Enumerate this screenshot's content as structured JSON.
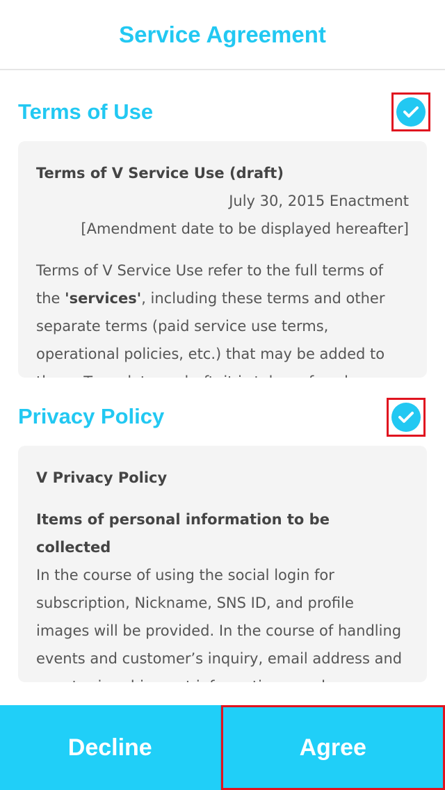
{
  "header": {
    "title": "Service Agreement"
  },
  "terms": {
    "title": "Terms of Use",
    "checked": true,
    "doc_title": "Terms of V Service Use (draft)",
    "enactment": "July 30, 2015 Enactment",
    "amendment": "[Amendment date to be displayed hereafter]",
    "body_prefix": "Terms of V Service Use refer to the full terms of the ",
    "body_bold": "'services'",
    "body_suffix": ", including these terms and other separate terms (paid service use terms, operational policies, etc.) that may be added to them. To update or draft, it is taken of each"
  },
  "privacy": {
    "title": "Privacy Policy",
    "checked": true,
    "doc_title": "V Privacy Policy",
    "subhead": "Items of personal information to be collected",
    "body": "In the course of using the social login for subscription, Nickname, SNS ID, and profile images will be provided. In the course of handling events and customer’s inquiry, email address and event prize shipment information may be additionally collected and for the friends"
  },
  "buttons": {
    "decline": "Decline",
    "agree": "Agree"
  },
  "colors": {
    "accent": "#22c8f2",
    "button": "#20cff8",
    "highlight": "#e0141f"
  },
  "icons": {
    "check": "check-icon"
  }
}
